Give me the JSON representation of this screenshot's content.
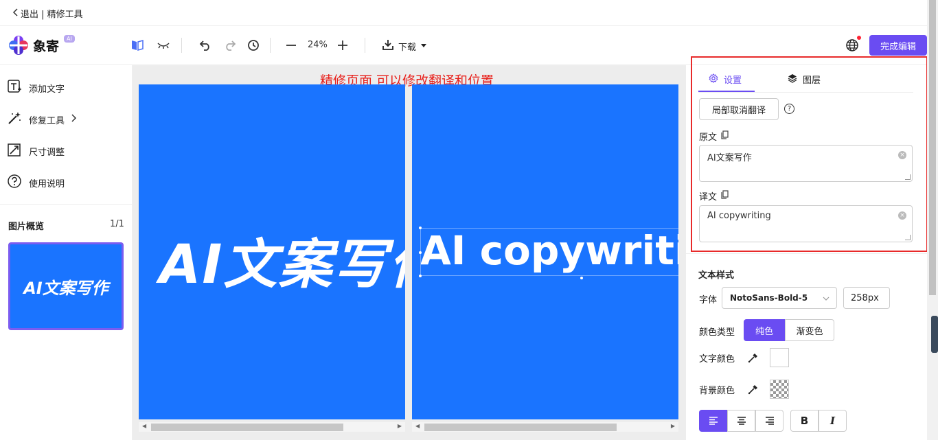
{
  "topbar": {
    "exit_label": "退出 | 精修工具"
  },
  "logo": {
    "name": "象寄",
    "badge": "AI"
  },
  "toolbar": {
    "zoom": "24%",
    "download_label": "下载",
    "finish_label": "完成编辑",
    "icons": [
      "compare-icon",
      "eye-closed-icon",
      "undo-icon",
      "redo-icon",
      "history-icon",
      "zoom-out-icon",
      "zoom-in-icon",
      "download-icon",
      "caret-down-icon",
      "globe-icon"
    ]
  },
  "sidebar": {
    "items": [
      {
        "label": "添加文字",
        "icon": "add-text-icon"
      },
      {
        "label": "修复工具",
        "icon": "magic-wand-icon",
        "suffix": ">"
      },
      {
        "label": "尺寸调整",
        "icon": "resize-icon"
      },
      {
        "label": "使用说明",
        "icon": "help-icon"
      }
    ],
    "overview_title": "图片概览",
    "overview_count": "1/1",
    "thumbnail_text": "AI文案写作"
  },
  "canvas": {
    "notice": "精修页面  可以修改翻译和位置",
    "original_text": "AI文案写作",
    "translated_text": "AI copywriting",
    "image_bg": "#1a74ff"
  },
  "panel": {
    "tabs": [
      {
        "label": "设置",
        "icon": "gear-icon",
        "active": true
      },
      {
        "label": "图层",
        "icon": "layers-icon",
        "active": false
      }
    ],
    "local_cancel_btn": "局部取消翻译",
    "original_label": "原文",
    "original_value": "AI文案写作",
    "translation_label": "译文",
    "translation_value": "AI copywriting",
    "text_style_title": "文本样式",
    "font_label": "字体",
    "font_value": "NotoSans-Bold-5",
    "font_size": "258px",
    "color_type_label": "颜色类型",
    "color_type_options": [
      "纯色",
      "渐变色"
    ],
    "text_color_label": "文字颜色",
    "bg_color_label": "背景颜色",
    "bold_label": "B",
    "italic_label": "I"
  },
  "colors": {
    "accent": "#6a4cf2",
    "notice": "#e8211c",
    "highlight_box": "#e82a2a"
  }
}
